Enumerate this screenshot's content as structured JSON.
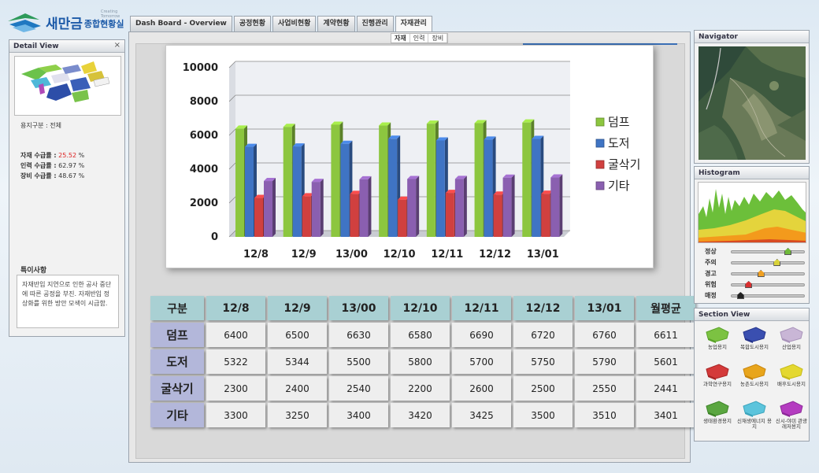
{
  "logo": {
    "brand": "새만금",
    "sub": "종합현황실",
    "tiny": "Creating Tomorrow"
  },
  "tabs": [
    "Dash Board - Overview",
    "공정현황",
    "사업비현황",
    "계약현황",
    "진행관리",
    "자재관리"
  ],
  "subtabs": [
    "자재",
    "인력",
    "장비"
  ],
  "detail_view": {
    "title": "Detail View",
    "close": "×",
    "site_label": "용지구분 : 전체",
    "material_label": "자재 수급률 :",
    "material_value": "25.52",
    "labor_label": "인력 수급률 :",
    "labor_value": "62.97 %",
    "equip_label": "장비 수급률 :",
    "equip_value": "48.67 %",
    "percent": "%",
    "notes_title": "특이사항",
    "notes": "자재반입 지연으로 인한 공사 중단에 따른 공정을 부진. 자재반입 정상화를 위한 방안 모색이 시급함."
  },
  "chart_data": {
    "type": "bar",
    "categories": [
      "12/8",
      "12/9",
      "13/00",
      "12/10",
      "12/11",
      "12/12",
      "13/01"
    ],
    "series": [
      {
        "name": "덤프",
        "values": [
          6400,
          6500,
          6630,
          6580,
          6690,
          6720,
          6760
        ],
        "color": "#8cc63f"
      },
      {
        "name": "도저",
        "values": [
          5322,
          5344,
          5500,
          5800,
          5700,
          5750,
          5790
        ],
        "color": "#3f74c4"
      },
      {
        "name": "굴삭기",
        "values": [
          2300,
          2400,
          2540,
          2200,
          2600,
          2500,
          2550
        ],
        "color": "#d0403f"
      },
      {
        "name": "기타",
        "values": [
          3300,
          3250,
          3400,
          3420,
          3425,
          3500,
          3510
        ],
        "color": "#8a5fb0"
      }
    ],
    "ylim": [
      0,
      10000
    ],
    "yticks": [
      "0",
      "2000",
      "4000",
      "6000",
      "8000",
      "10000"
    ],
    "legend": "right",
    "grid": true
  },
  "table": {
    "corner": "구분",
    "headers": [
      "12/8",
      "12/9",
      "13/00",
      "12/10",
      "12/11",
      "12/12",
      "13/01",
      "월평균"
    ],
    "rows": [
      {
        "label": "덤프",
        "cells": [
          "6400",
          "6500",
          "6630",
          "6580",
          "6690",
          "6720",
          "6760",
          "6611"
        ]
      },
      {
        "label": "도저",
        "cells": [
          "5322",
          "5344",
          "5500",
          "5800",
          "5700",
          "5750",
          "5790",
          "5601"
        ]
      },
      {
        "label": "굴삭기",
        "cells": [
          "2300",
          "2400",
          "2540",
          "2200",
          "2600",
          "2500",
          "2550",
          "2441"
        ]
      },
      {
        "label": "기타",
        "cells": [
          "3300",
          "3250",
          "3400",
          "3420",
          "3425",
          "3500",
          "3510",
          "3401"
        ]
      }
    ]
  },
  "navigator": {
    "title": "Navigator"
  },
  "histogram": {
    "title": "Histogram",
    "levels": [
      {
        "label": "정상",
        "color": "#6fb93a",
        "value": 0.78
      },
      {
        "label": "주의",
        "color": "#d8d23a",
        "value": 0.62
      },
      {
        "label": "경고",
        "color": "#f0a022",
        "value": 0.38
      },
      {
        "label": "위험",
        "color": "#d83030",
        "value": 0.2
      },
      {
        "label": "매정",
        "color": "#222222",
        "value": 0.08
      }
    ]
  },
  "section_view": {
    "title": "Section View",
    "items": [
      "농업용지",
      "복합도시용지",
      "산업용지",
      "과학연구용지",
      "농촌도시용지",
      "배후도시용지",
      "생태환경용지",
      "신재생에너지 용지",
      "신시-야미 관광레저용지"
    ]
  }
}
